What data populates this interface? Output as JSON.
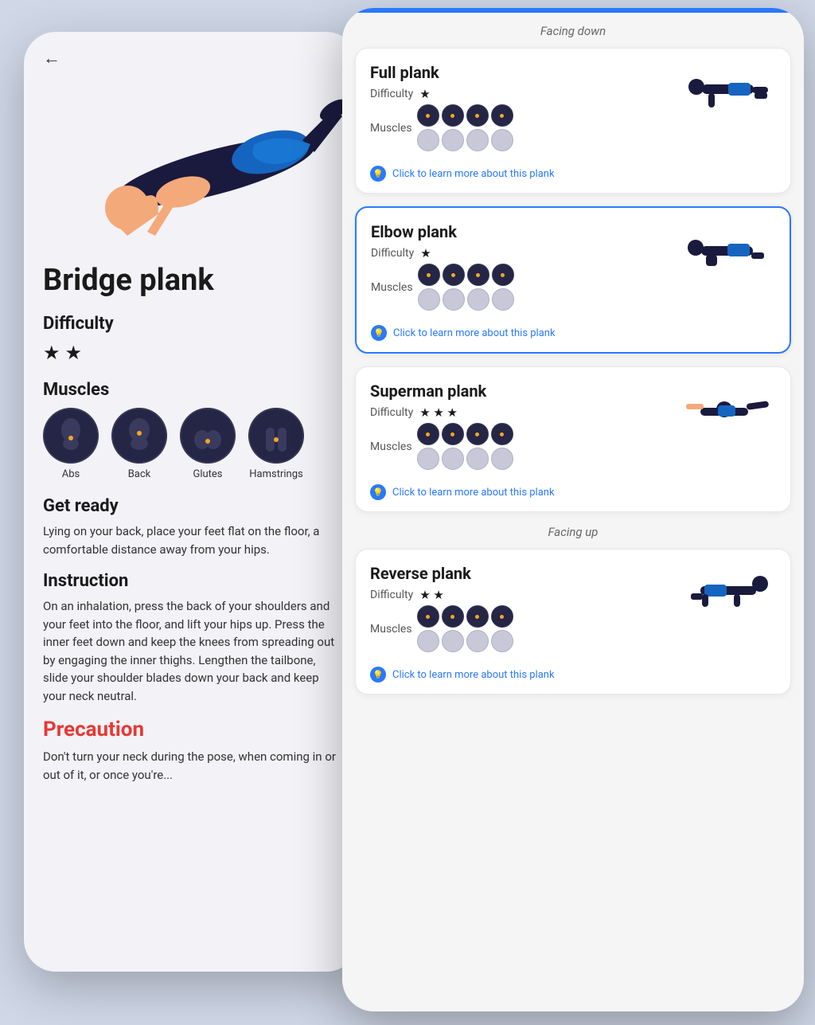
{
  "leftPhone": {
    "backArrow": "←",
    "exerciseTitle": "Bridge plank",
    "difficultyLabel": "Difficulty",
    "difficultyStars": "★ ★",
    "musclesLabel": "Muscles",
    "muscles": [
      {
        "name": "Abs"
      },
      {
        "name": "Back"
      },
      {
        "name": "Glutes"
      },
      {
        "name": "Hamstrings"
      }
    ],
    "getReadyHeading": "Get ready",
    "getReadyText": "Lying on your back, place your feet flat on the floor, a comfortable distance away from your hips.",
    "instructionHeading": "Instruction",
    "instructionText": "On an inhalation, press the back of your shoulders and your feet into the floor, and lift your hips up. Press the inner feet down and keep the knees from spreading out by engaging the inner thighs. Lengthen the tailbone, slide your shoulder blades down your back and keep your neck neutral.",
    "precautionHeading": "Precaution",
    "precautionText": "Don't turn your neck during the pose, when coming in or out of it, or once you're..."
  },
  "rightPhone": {
    "categoryFacingDown": "Facing down",
    "categoryFacingUp": "Facing up",
    "exercises": [
      {
        "id": "full-plank",
        "title": "Full plank",
        "difficultyLabel": "Difficulty",
        "stars": 1,
        "musclesLabel": "Muscles",
        "learnMore": "Click to learn more about this plank",
        "active": false
      },
      {
        "id": "elbow-plank",
        "title": "Elbow plank",
        "difficultyLabel": "Difficulty",
        "stars": 1,
        "musclesLabel": "Muscles",
        "learnMore": "Click to learn more about this plank",
        "active": true
      },
      {
        "id": "superman-plank",
        "title": "Superman plank",
        "difficultyLabel": "Difficulty",
        "stars": 3,
        "musclesLabel": "Muscles",
        "learnMore": "Click to learn more about this plank",
        "active": false
      },
      {
        "id": "reverse-plank",
        "title": "Reverse plank",
        "difficultyLabel": "Difficulty",
        "stars": 2,
        "musclesLabel": "Muscles",
        "learnMore": "Click to learn more about this plank",
        "active": false
      }
    ]
  }
}
